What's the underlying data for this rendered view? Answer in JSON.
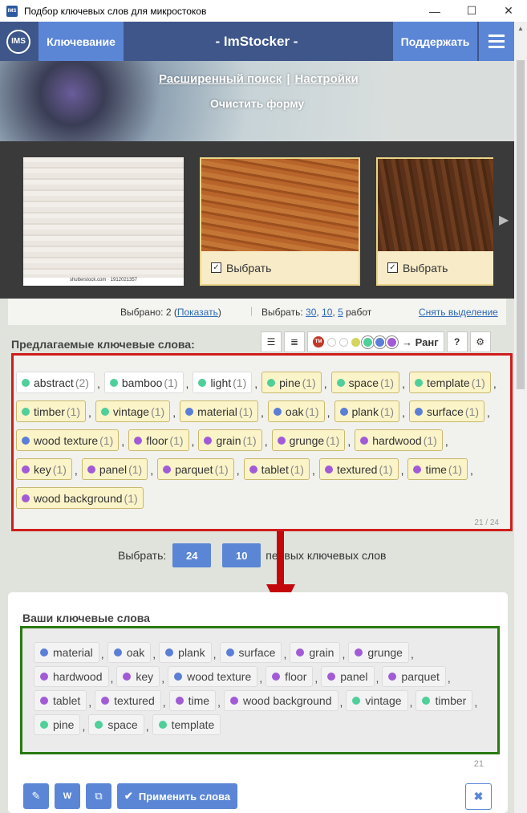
{
  "window": {
    "title": "Подбор ключевых слов для микростоков",
    "min": "—",
    "max": "☐",
    "close": "✕"
  },
  "navbar": {
    "logo": "IMS",
    "keywording": "Ключевание",
    "title": "- ImStocker -",
    "support": "Поддержать"
  },
  "hero": {
    "advanced_search": "Расширенный поиск",
    "sep": "|",
    "settings": "Настройки",
    "clear_form": "Очистить форму"
  },
  "images": [
    {
      "credit": "shutterstock.com · 1912021357"
    },
    {
      "pick_label": "Выбрать",
      "checked": true
    },
    {
      "pick_label": "Выбрать",
      "checked": true
    }
  ],
  "selection": {
    "selected_prefix": "Выбрано: 2 (",
    "show": "Показать",
    "selected_suffix": ")",
    "sep": "|",
    "choose_prefix": "Выбрать: ",
    "n30": "30",
    "n10": "10",
    "n5": "5",
    "works": "работ",
    "clear": "Снять выделение"
  },
  "suggested": {
    "title": "Предлагаемые ключевые слова:",
    "rank_label": "Ранг",
    "help": "?",
    "tm": "TM",
    "counter": "21 / 24",
    "keywords": [
      {
        "word": "abstract",
        "count": "(2)",
        "color": "g",
        "white": true
      },
      {
        "word": "bamboo",
        "count": "(1)",
        "color": "g",
        "white": true
      },
      {
        "word": "light",
        "count": "(1)",
        "color": "g",
        "white": true
      },
      {
        "word": "pine",
        "count": "(1)",
        "color": "g"
      },
      {
        "word": "space",
        "count": "(1)",
        "color": "g"
      },
      {
        "word": "template",
        "count": "(1)",
        "color": "g"
      },
      {
        "word": "timber",
        "count": "(1)",
        "color": "g"
      },
      {
        "word": "vintage",
        "count": "(1)",
        "color": "g"
      },
      {
        "word": "material",
        "count": "(1)",
        "color": "b"
      },
      {
        "word": "oak",
        "count": "(1)",
        "color": "b"
      },
      {
        "word": "plank",
        "count": "(1)",
        "color": "b"
      },
      {
        "word": "surface",
        "count": "(1)",
        "color": "b"
      },
      {
        "word": "wood texture",
        "count": "(1)",
        "color": "b"
      },
      {
        "word": "floor",
        "count": "(1)",
        "color": "p"
      },
      {
        "word": "grain",
        "count": "(1)",
        "color": "p"
      },
      {
        "word": "grunge",
        "count": "(1)",
        "color": "p"
      },
      {
        "word": "hardwood",
        "count": "(1)",
        "color": "p"
      },
      {
        "word": "key",
        "count": "(1)",
        "color": "p"
      },
      {
        "word": "panel",
        "count": "(1)",
        "color": "p"
      },
      {
        "word": "parquet",
        "count": "(1)",
        "color": "p"
      },
      {
        "word": "tablet",
        "count": "(1)",
        "color": "p"
      },
      {
        "word": "textured",
        "count": "(1)",
        "color": "p"
      },
      {
        "word": "time",
        "count": "(1)",
        "color": "p"
      },
      {
        "word": "wood background",
        "count": "(1)",
        "color": "p"
      }
    ]
  },
  "choose_row": {
    "label": "Выбрать:",
    "b24": "24",
    "b10": "10",
    "suffix": "первых ключевых слов"
  },
  "yours": {
    "title": "Ваши ключевые слова",
    "counter": "21",
    "apply": "Применить слова",
    "keywords": [
      {
        "word": "material",
        "color": "b"
      },
      {
        "word": "oak",
        "color": "b"
      },
      {
        "word": "plank",
        "color": "b"
      },
      {
        "word": "surface",
        "color": "b"
      },
      {
        "word": "grain",
        "color": "p"
      },
      {
        "word": "grunge",
        "color": "p"
      },
      {
        "word": "hardwood",
        "color": "p"
      },
      {
        "word": "key",
        "color": "p"
      },
      {
        "word": "wood texture",
        "color": "b"
      },
      {
        "word": "floor",
        "color": "p"
      },
      {
        "word": "panel",
        "color": "p"
      },
      {
        "word": "parquet",
        "color": "p"
      },
      {
        "word": "tablet",
        "color": "p"
      },
      {
        "word": "textured",
        "color": "p"
      },
      {
        "word": "time",
        "color": "p"
      },
      {
        "word": "wood background",
        "color": "p"
      },
      {
        "word": "vintage",
        "color": "g"
      },
      {
        "word": "timber",
        "color": "g"
      },
      {
        "word": "pine",
        "color": "g"
      },
      {
        "word": "space",
        "color": "g"
      },
      {
        "word": "template",
        "color": "g"
      }
    ]
  },
  "colors": {
    "nav": "#304a82",
    "accent": "#5b86d6",
    "red_frame": "#d01c1c",
    "green_frame": "#2a7a10",
    "arrow": "#c4070b"
  }
}
